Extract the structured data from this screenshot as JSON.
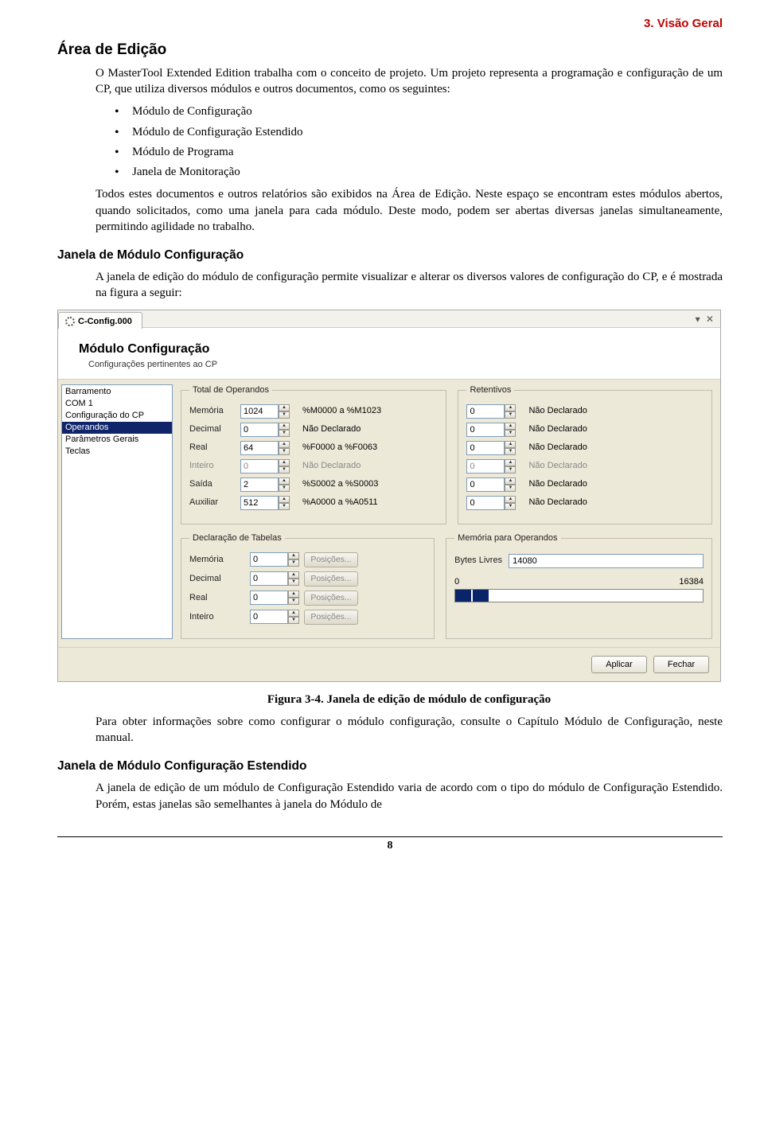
{
  "header": {
    "right": "3. Visão Geral"
  },
  "doc": {
    "h_area": "Área de Edição",
    "p1": "O MasterTool Extended Edition trabalha com o conceito de projeto. Um projeto representa a programação e configuração de um CP, que utiliza diversos módulos e outros documentos, como os seguintes:",
    "bullets": [
      "Módulo de Configuração",
      "Módulo de Configuração Estendido",
      "Módulo de Programa",
      "Janela de Monitoração"
    ],
    "p2": "Todos estes documentos e outros relatórios são exibidos na Área de Edição. Neste espaço se encontram estes módulos abertos, quando solicitados, como uma janela para cada módulo. Deste modo, podem ser abertas diversas janelas simultaneamente, permitindo agilidade no trabalho.",
    "h_janela_cfg": "Janela de Módulo Configuração",
    "p3": "A janela de edição do módulo de configuração permite visualizar e alterar os diversos valores de configuração do CP, e é mostrada na figura a seguir:",
    "fig_caption": "Figura 3-4. Janela de edição de módulo de configuração",
    "p4": "Para obter informações sobre como configurar o módulo configuração, consulte o Capítulo Módulo de Configuração, neste manual.",
    "h_janela_ext": "Janela de Módulo Configuração Estendido",
    "p5": "A janela de edição de um módulo de Configuração Estendido varia de acordo com o tipo do módulo de Configuração Estendido. Porém, estas janelas são semelhantes à janela do Módulo de",
    "pagenum": "8"
  },
  "win": {
    "tab_label": "C-Config.000",
    "tab_ctrls": "▾  ✕",
    "title": "Módulo Configuração",
    "subtitle": "Configurações pertinentes ao CP",
    "nav": [
      "Barramento",
      "COM 1",
      "Configuração do CP",
      "Operandos",
      "Parâmetros Gerais",
      "Teclas"
    ],
    "nav_selected": 3,
    "grp_total": "Total de Operandos",
    "grp_ret": "Retentivos",
    "grp_decl": "Declaração de Tabelas",
    "grp_mem": "Memória para Operandos",
    "rows": {
      "labels": [
        "Memória",
        "Decimal",
        "Real",
        "Inteiro",
        "Saída",
        "Auxiliar"
      ],
      "values": [
        "1024",
        "0",
        "64",
        "0",
        "2",
        "512"
      ],
      "ranges": [
        "%M0000 a %M1023",
        "Não Declarado",
        "%F0000 a %F0063",
        "Não Declarado",
        "%S0002 a %S0003",
        "%A0000 a %A0511"
      ],
      "row_dim": [
        false,
        false,
        false,
        true,
        false,
        false
      ],
      "ret_values": [
        "0",
        "0",
        "0",
        "0",
        "0",
        "0"
      ],
      "ret_ranges": [
        "Não Declarado",
        "Não Declarado",
        "Não Declarado",
        "Não Declarado",
        "Não Declarado",
        "Não Declarado"
      ]
    },
    "decl": {
      "labels": [
        "Memória",
        "Decimal",
        "Real",
        "Inteiro"
      ],
      "values": [
        "0",
        "0",
        "0",
        "0"
      ],
      "btn": "Posições..."
    },
    "mem": {
      "bytes_label": "Bytes Livres",
      "bytes_value": "14080",
      "min": "0",
      "max": "16384",
      "fill_pct": 14
    },
    "btn_apply": "Aplicar",
    "btn_close": "Fechar"
  }
}
